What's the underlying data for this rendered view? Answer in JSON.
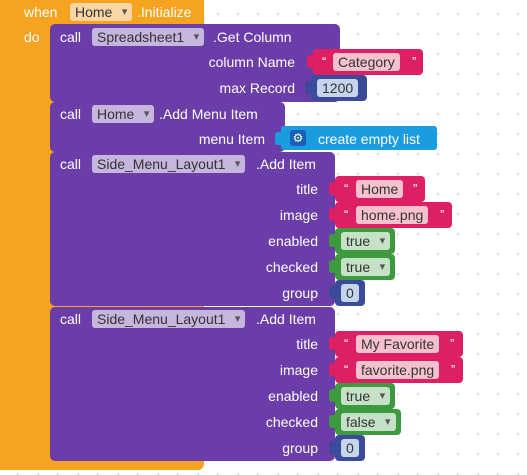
{
  "event": {
    "when": "when",
    "component": "Home",
    "event_name": ".Initialize",
    "do": "do"
  },
  "blocks": [
    {
      "call": "call",
      "component": "Spreadsheet1",
      "method": ".Get Column",
      "args": [
        {
          "label": "column Name",
          "kind": "text",
          "value": "Category"
        },
        {
          "label": "max Record",
          "kind": "number",
          "value": "1200"
        }
      ]
    },
    {
      "call": "call",
      "component": "Home",
      "method": ".Add Menu Item",
      "args": [
        {
          "label": "menu Item",
          "kind": "list",
          "value": "create empty list",
          "icon": "gear-icon"
        }
      ]
    },
    {
      "call": "call",
      "component": "Side_Menu_Layout1",
      "method": ".Add Item",
      "args": [
        {
          "label": "title",
          "kind": "text",
          "value": "Home"
        },
        {
          "label": "image",
          "kind": "text",
          "value": "home.png"
        },
        {
          "label": "enabled",
          "kind": "bool",
          "value": "true"
        },
        {
          "label": "checked",
          "kind": "bool",
          "value": "true"
        },
        {
          "label": "group",
          "kind": "number",
          "value": "0"
        }
      ]
    },
    {
      "call": "call",
      "component": "Side_Menu_Layout1",
      "method": ".Add Item",
      "args": [
        {
          "label": "title",
          "kind": "text",
          "value": "My Favorite"
        },
        {
          "label": "image",
          "kind": "text",
          "value": "favorite.png"
        },
        {
          "label": "enabled",
          "kind": "bool",
          "value": "true"
        },
        {
          "label": "checked",
          "kind": "bool",
          "value": "false"
        },
        {
          "label": "group",
          "kind": "number",
          "value": "0"
        }
      ]
    }
  ],
  "quote": "“",
  "quote_close": "”",
  "colors": {
    "event": "#f6a321",
    "procedure": "#6a3da8",
    "text": "#de1f63",
    "number": "#3b4b9a",
    "logic": "#3d9a3f",
    "list": "#1a9ce0"
  }
}
